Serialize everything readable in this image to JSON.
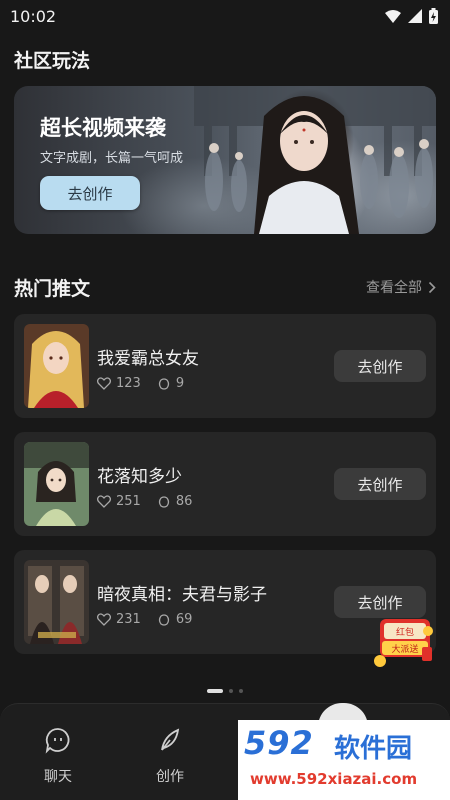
{
  "status_bar": {
    "time": "10:02"
  },
  "community": {
    "section_title": "社区玩法",
    "banner": {
      "title": "超长视频来袭",
      "subtitle": "文字成剧，长篇一气呵成",
      "button_label": "去创作"
    }
  },
  "hot_posts": {
    "section_title": "热门推文",
    "view_all_label": "查看全部",
    "items": [
      {
        "title": "我爱霸总女友",
        "likes": "123",
        "remixes": "9",
        "button_label": "去创作"
      },
      {
        "title": "花落知多少",
        "likes": "251",
        "remixes": "86",
        "button_label": "去创作"
      },
      {
        "title": "暗夜真相：夫君与影子",
        "likes": "231",
        "remixes": "69",
        "button_label": "去创作"
      }
    ]
  },
  "pagination": {
    "total": 3,
    "active": 1
  },
  "tabbar": {
    "items": [
      {
        "label": "聊天",
        "icon": "chat-bubble-icon"
      },
      {
        "label": "创作",
        "icon": "feather-icon"
      }
    ]
  },
  "watermark": {
    "logo": "592",
    "brand": "软件园",
    "url": "www.592xiazai.com"
  },
  "promo": {
    "text": "红包大派送"
  },
  "colors": {
    "background": "#181818",
    "card": "#262626",
    "primary_button": "#b9dcf0"
  }
}
